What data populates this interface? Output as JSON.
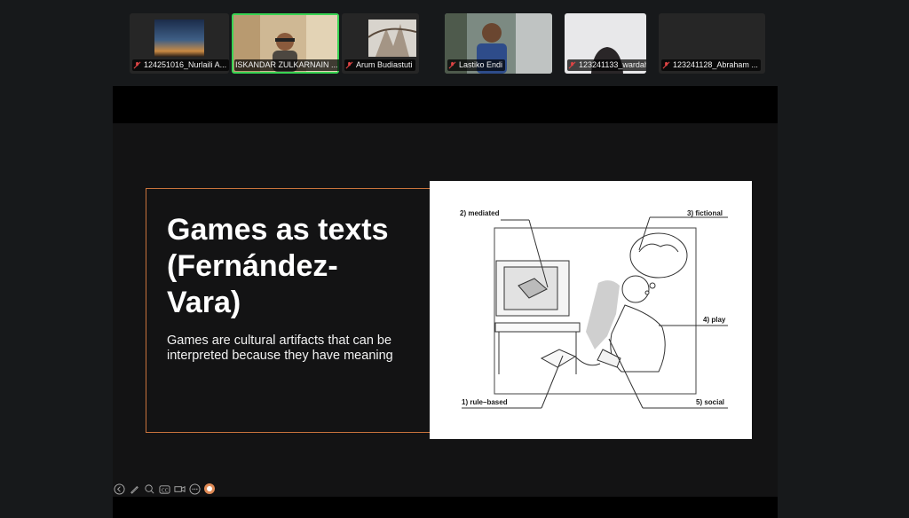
{
  "participants": [
    {
      "name": "124251016_Nurlaili A...",
      "muted": true
    },
    {
      "name": "ISKANDAR ZULKARNAIN ...",
      "muted": false,
      "active": true
    },
    {
      "name": "Arum Budiastuti",
      "muted": true
    },
    {
      "name": "Lastiko Endi",
      "muted": true
    },
    {
      "name": "123241133_wardah as...",
      "muted": true
    },
    {
      "name": "123241128_Abraham ...",
      "muted": true
    }
  ],
  "slide": {
    "title": "Games as texts (Fernández-Vara)",
    "title_lines": [
      "Games as texts",
      "(Fernández-",
      "Vara)"
    ],
    "subtitle": "Games are cultural artifacts that can be interpreted because they have meaning",
    "figure_labels": {
      "mediated": "2) mediated",
      "fictional": "3) fictional",
      "play": "4) play",
      "rule_based": "1) rule–based",
      "social": "5) social"
    }
  },
  "colors": {
    "background": "#17191b",
    "accent_frame": "#c8733c",
    "active_speaker": "#39d353",
    "muted_icon": "#e04545"
  },
  "toolbar_icons": [
    "back-icon",
    "pen-icon",
    "zoom-icon",
    "captions-icon",
    "video-icon",
    "more-icon",
    "pointer-icon"
  ]
}
